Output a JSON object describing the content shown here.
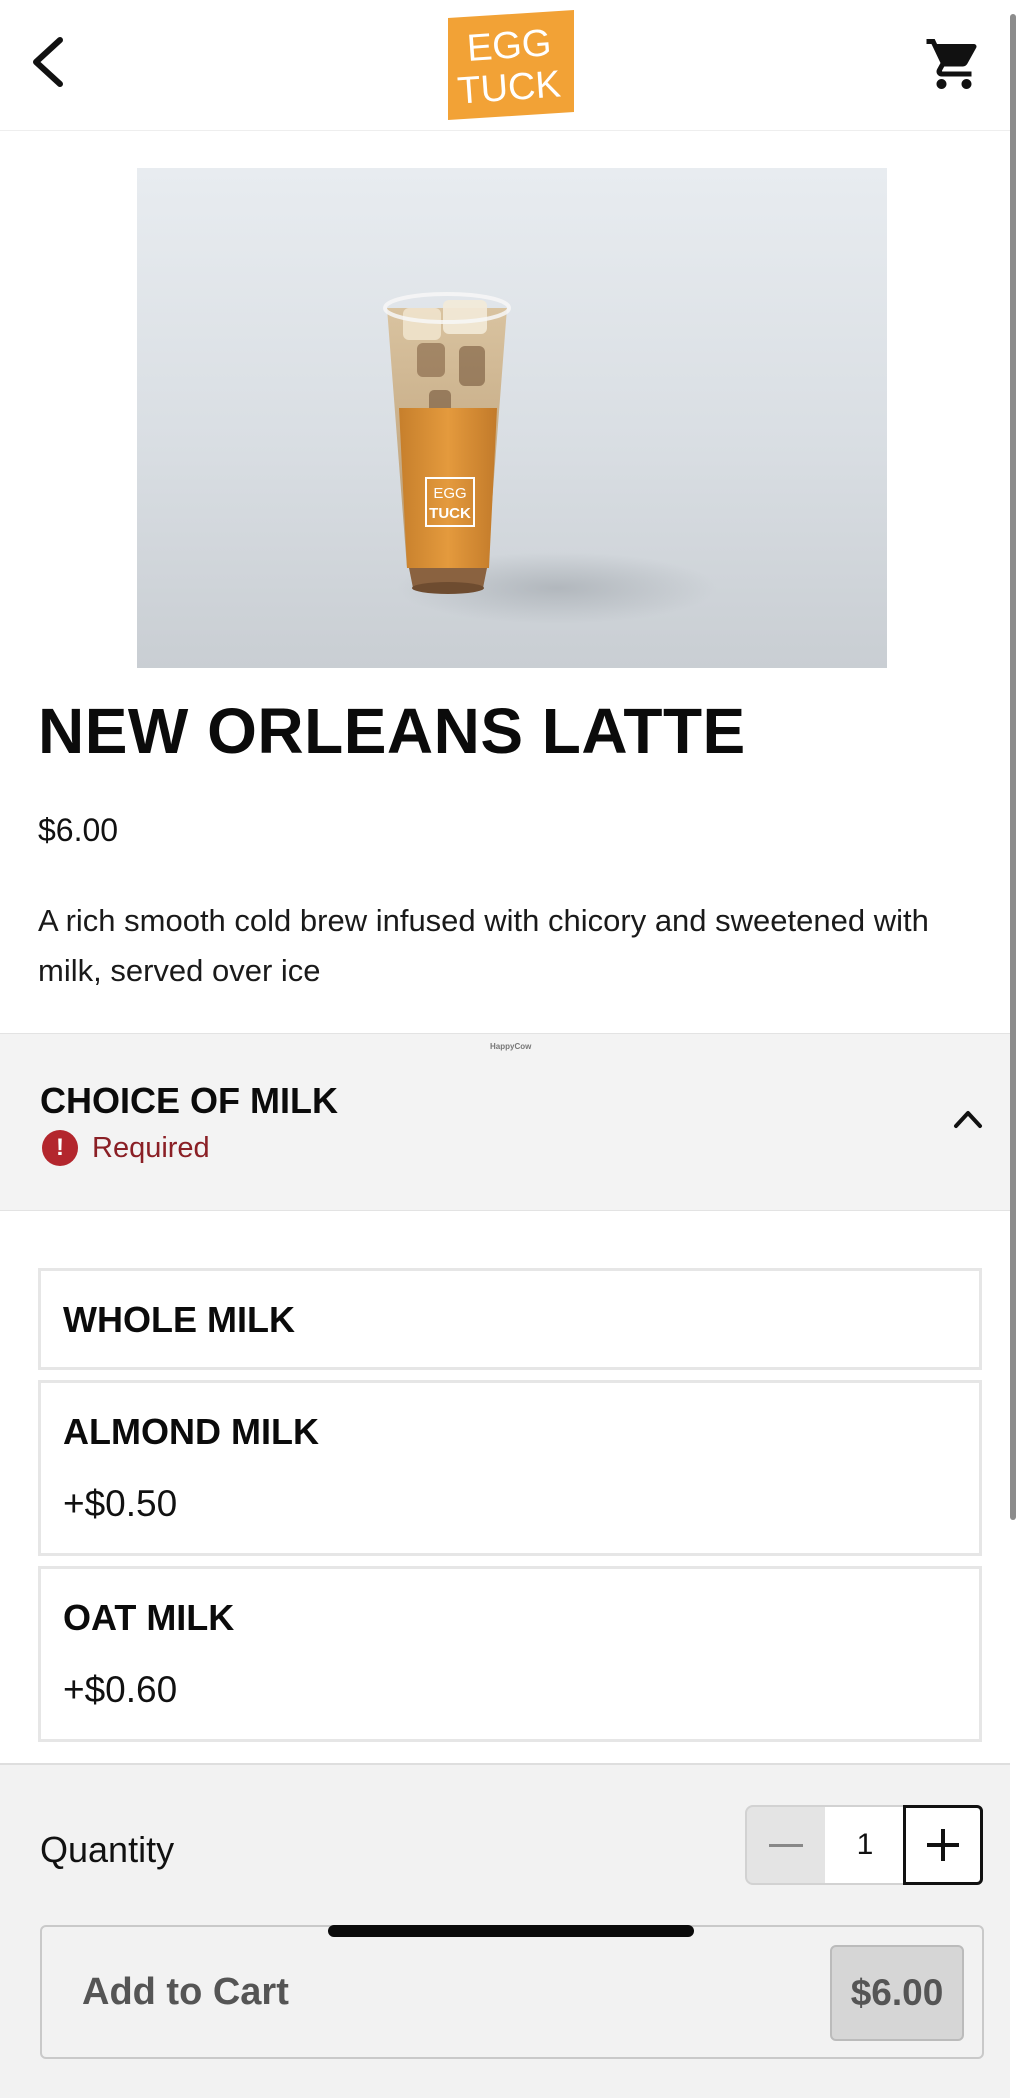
{
  "header": {
    "back_icon": "chevron-left-icon",
    "logo_line1": "EGG",
    "logo_line2": "TUCK",
    "cart_icon": "shopping-cart-icon"
  },
  "product": {
    "image_sleeve_line1": "EGG",
    "image_sleeve_line2": "TUCK",
    "name": "NEW ORLEANS LATTE",
    "price": "$6.00",
    "description": "A rich smooth cold brew infused with chicory and sweetened with milk, served over ice"
  },
  "modifier_group": {
    "watermark": "HappyCow",
    "title": "CHOICE OF MILK",
    "required_label": "Required",
    "required_icon": "exclamation-icon",
    "toggle_icon": "chevron-up-icon",
    "options": [
      {
        "name": "WHOLE MILK",
        "price": ""
      },
      {
        "name": "ALMOND MILK",
        "price": "+$0.50"
      },
      {
        "name": "OAT MILK",
        "price": "+$0.60"
      }
    ]
  },
  "footer": {
    "quantity_label": "Quantity",
    "quantity_value": "1",
    "add_to_cart_label": "Add to Cart",
    "add_to_cart_price": "$6.00"
  },
  "colors": {
    "brand_orange": "#F2A236",
    "required_red": "#B3262D",
    "panel_gray": "#F3F3F3"
  }
}
